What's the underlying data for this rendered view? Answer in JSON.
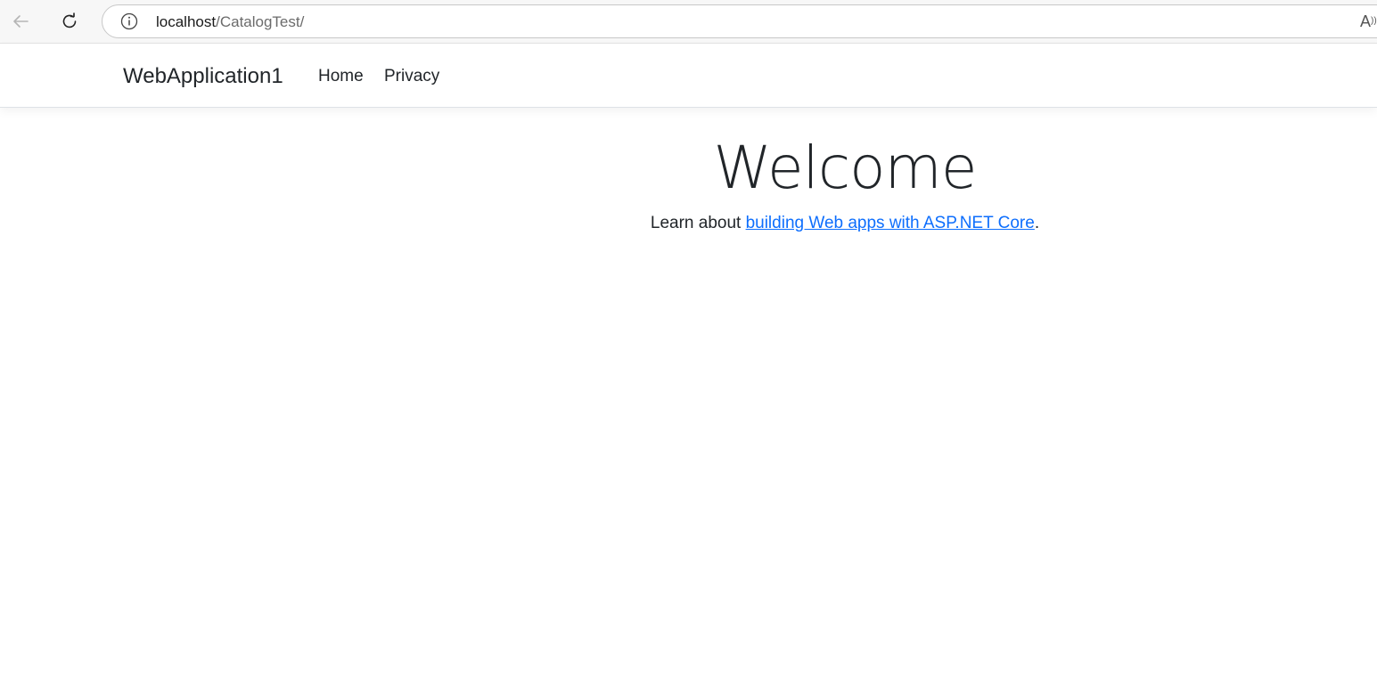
{
  "browser": {
    "url_host": "localhost",
    "url_path": "/CatalogTest/",
    "read_aloud_glyph": "A"
  },
  "navbar": {
    "brand": "WebApplication1",
    "links": [
      {
        "label": "Home"
      },
      {
        "label": "Privacy"
      }
    ]
  },
  "main": {
    "title": "Welcome",
    "learn_prefix": "Learn about ",
    "learn_link": "building Web apps with ASP.NET Core",
    "learn_suffix": "."
  },
  "colors": {
    "link": "#0d6efd",
    "text": "#212529"
  },
  "icons": {
    "back": "back-arrow-icon",
    "reload": "reload-icon",
    "info": "info-icon",
    "read_aloud": "read-aloud-icon"
  }
}
